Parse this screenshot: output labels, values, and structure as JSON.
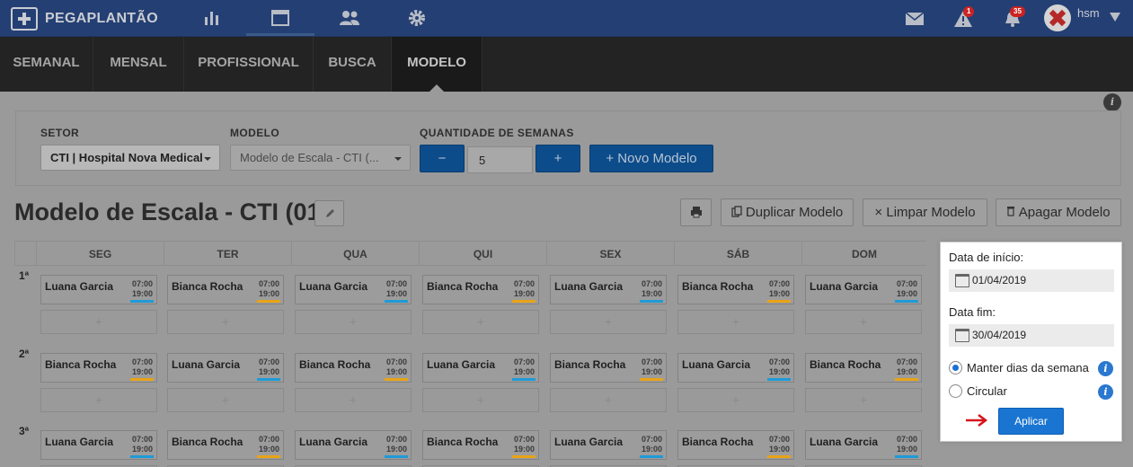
{
  "topbar": {
    "logo_text": "PEGAPLANTÃO",
    "nav_icons": [
      "bar-chart-icon",
      "calendar-window-icon",
      "people-icon",
      "gear-icon"
    ],
    "mail_icon": "mail-icon",
    "alert_icon": "warning-icon",
    "alert_badge": "1",
    "bell_icon": "bell-icon",
    "bell_badge": "35",
    "user_name": "hsm",
    "brand_color": "#243f73"
  },
  "tabs": [
    {
      "label": "SEMANAL",
      "active": false
    },
    {
      "label": "MENSAL",
      "active": false
    },
    {
      "label": "PROFISSIONAL",
      "active": false
    },
    {
      "label": "BUSCA",
      "active": false
    },
    {
      "label": "MODELO",
      "active": true
    }
  ],
  "filters": {
    "setor_label": "SETOR",
    "setor_value": "CTI | Hospital Nova Medical",
    "modelo_label": "MODELO",
    "modelo_value": "Modelo de Escala - CTI (...",
    "quantidade_label": "QUANTIDADE DE SEMANAS",
    "minus_label": "−",
    "quantidade_value": "5",
    "plus_label": "+",
    "novo_modelo_label": "+ Novo Modelo"
  },
  "title": {
    "text": "Modelo de Escala - CTI (01)",
    "duplicar_label": "Duplicar Modelo",
    "limpar_label": "× Limpar Modelo",
    "apagar_label": "Apagar Modelo"
  },
  "grid": {
    "days": [
      "SEG",
      "TER",
      "QUA",
      "QUI",
      "SEX",
      "SÁB",
      "DOM"
    ],
    "add_label": "+",
    "weeks": [
      {
        "label": "1ª",
        "shifts": [
          {
            "name": "Luana Garcia",
            "start": "07:00",
            "end": "19:00",
            "color": "#1e9bd7"
          },
          {
            "name": "Bianca Rocha",
            "start": "07:00",
            "end": "19:00",
            "color": "#e8a317"
          },
          {
            "name": "Luana Garcia",
            "start": "07:00",
            "end": "19:00",
            "color": "#1e9bd7"
          },
          {
            "name": "Bianca Rocha",
            "start": "07:00",
            "end": "19:00",
            "color": "#e8a317"
          },
          {
            "name": "Luana Garcia",
            "start": "07:00",
            "end": "19:00",
            "color": "#1e9bd7"
          },
          {
            "name": "Bianca Rocha",
            "start": "07:00",
            "end": "19:00",
            "color": "#e8a317"
          },
          {
            "name": "Luana Garcia",
            "start": "07:00",
            "end": "19:00",
            "color": "#1e9bd7"
          }
        ]
      },
      {
        "label": "2ª",
        "shifts": [
          {
            "name": "Bianca Rocha",
            "start": "07:00",
            "end": "19:00",
            "color": "#e8a317"
          },
          {
            "name": "Luana Garcia",
            "start": "07:00",
            "end": "19:00",
            "color": "#1e9bd7"
          },
          {
            "name": "Bianca Rocha",
            "start": "07:00",
            "end": "19:00",
            "color": "#e8a317"
          },
          {
            "name": "Luana Garcia",
            "start": "07:00",
            "end": "19:00",
            "color": "#1e9bd7"
          },
          {
            "name": "Bianca Rocha",
            "start": "07:00",
            "end": "19:00",
            "color": "#e8a317"
          },
          {
            "name": "Luana Garcia",
            "start": "07:00",
            "end": "19:00",
            "color": "#1e9bd7"
          },
          {
            "name": "Bianca Rocha",
            "start": "07:00",
            "end": "19:00",
            "color": "#e8a317"
          }
        ]
      },
      {
        "label": "3ª",
        "shifts": [
          {
            "name": "Luana Garcia",
            "start": "07:00",
            "end": "19:00",
            "color": "#1e9bd7"
          },
          {
            "name": "Bianca Rocha",
            "start": "07:00",
            "end": "19:00",
            "color": "#e8a317"
          },
          {
            "name": "Luana Garcia",
            "start": "07:00",
            "end": "19:00",
            "color": "#1e9bd7"
          },
          {
            "name": "Bianca Rocha",
            "start": "07:00",
            "end": "19:00",
            "color": "#e8a317"
          },
          {
            "name": "Luana Garcia",
            "start": "07:00",
            "end": "19:00",
            "color": "#1e9bd7"
          },
          {
            "name": "Bianca Rocha",
            "start": "07:00",
            "end": "19:00",
            "color": "#e8a317"
          },
          {
            "name": "Luana Garcia",
            "start": "07:00",
            "end": "19:00",
            "color": "#1e9bd7"
          }
        ]
      }
    ]
  },
  "popup": {
    "start_label": "Data de início:",
    "start_value": "01/04/2019",
    "end_label": "Data fim:",
    "end_value": "30/04/2019",
    "option_keep": "Manter dias da semana",
    "option_circular": "Circular",
    "apply_label": "Aplicar",
    "accent": "#1a75d2"
  }
}
